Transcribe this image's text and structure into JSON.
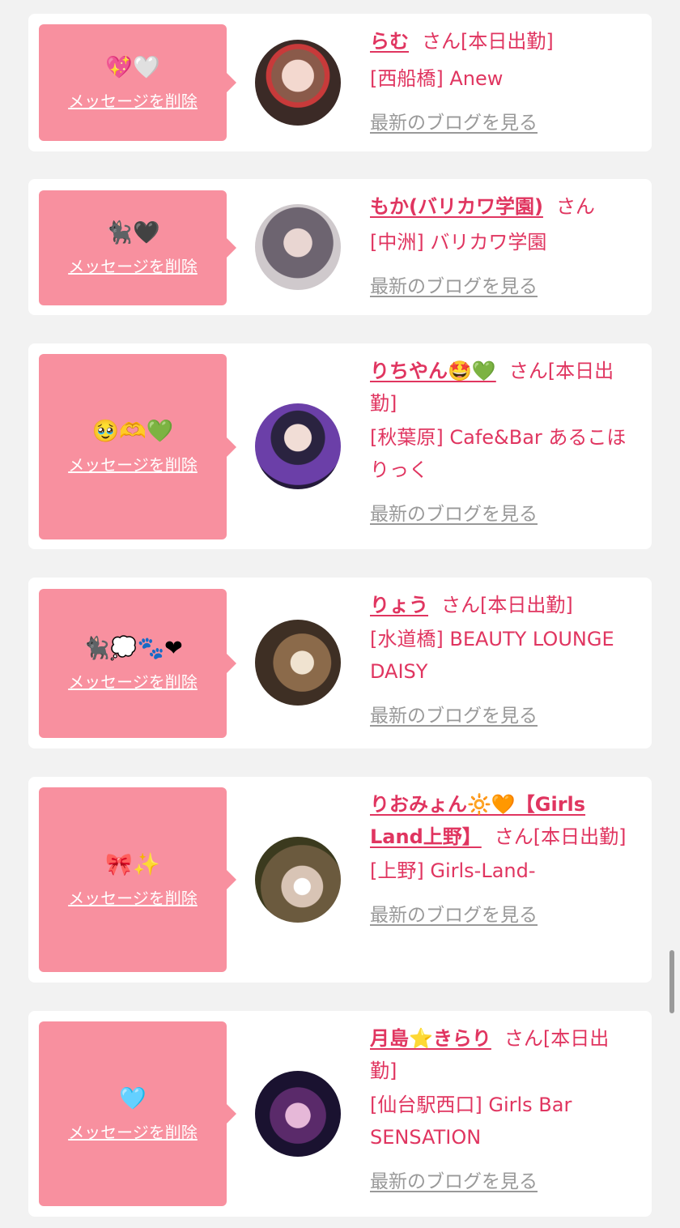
{
  "cards": [
    {
      "emoji": "💖🤍",
      "delete_label": "メッセージを削除",
      "name": "らむ",
      "honorific": "さん",
      "status": "[本日出勤]",
      "location": "[西船橋] Anew",
      "blog_link": "最新のブログを見る"
    },
    {
      "emoji": "🐈‍⬛🖤",
      "delete_label": "メッセージを削除",
      "name": "もか(バリカワ学園)",
      "honorific": "さん",
      "status": "",
      "location": "[中洲] バリカワ学園",
      "blog_link": "最新のブログを見る"
    },
    {
      "emoji": "🥹🫶💚",
      "delete_label": "メッセージを削除",
      "name": "りちやん🤩💚",
      "honorific": "さん",
      "status": "[本日出勤]",
      "location": "[秋葉原] Cafe&Bar あるこほりっく",
      "blog_link": "最新のブログを見る"
    },
    {
      "emoji": "🐈‍⬛💭🐾❤",
      "delete_label": "メッセージを削除",
      "name": "りょう",
      "honorific": "さん",
      "status": "[本日出勤]",
      "location": "[水道橋] BEAUTY LOUNGE DAISY",
      "blog_link": "最新のブログを見る"
    },
    {
      "emoji": "🎀✨",
      "delete_label": "メッセージを削除",
      "name": "りおみょん🔆🧡【Girls Land上野】",
      "honorific": "さん",
      "status": "[本日出勤]",
      "location": "[上野] Girls-Land-",
      "blog_link": "最新のブログを見る"
    },
    {
      "emoji": "🩵",
      "delete_label": "メッセージを削除",
      "name": "月島⭐️きらり",
      "honorific": "さん",
      "status": "[本日出勤]",
      "location": "[仙台駅西口] Girls Bar SENSATION",
      "blog_link": "最新のブログを見る"
    }
  ],
  "colors": {
    "accent": "#e03560",
    "bubble": "#f8909f",
    "muted": "#999999",
    "background": "#f2f2f2"
  }
}
